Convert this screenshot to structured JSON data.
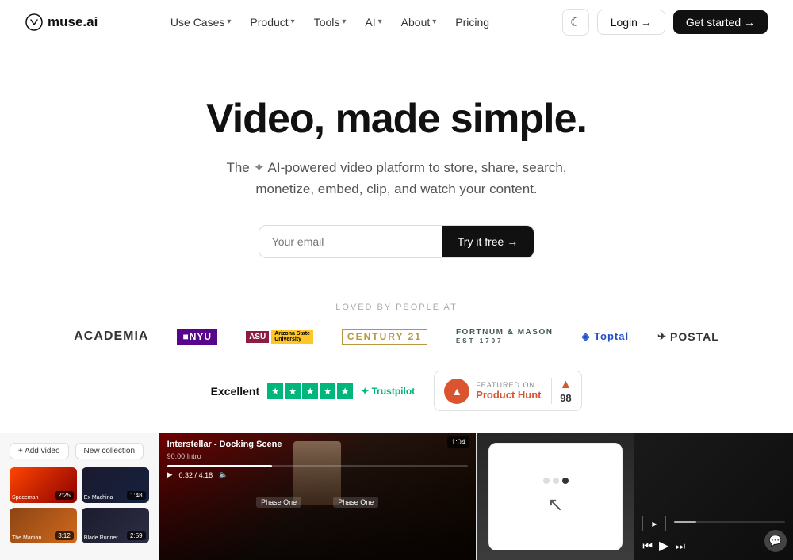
{
  "nav": {
    "logo_text": "muse.ai",
    "links": [
      {
        "label": "Use Cases",
        "has_dropdown": true
      },
      {
        "label": "Product",
        "has_dropdown": true
      },
      {
        "label": "Tools",
        "has_dropdown": true
      },
      {
        "label": "AI",
        "has_dropdown": true
      },
      {
        "label": "About",
        "has_dropdown": true
      },
      {
        "label": "Pricing",
        "has_dropdown": false
      }
    ],
    "login_label": "Login →",
    "get_started_label": "Get started →"
  },
  "hero": {
    "headline": "Video, made simple.",
    "subtext": "The ✦ AI-powered video platform to store, share, search, monetize, embed, clip, and watch your content.",
    "email_placeholder": "Your email",
    "cta_label": "Try it free →"
  },
  "social_proof": {
    "loved_label": "LOVED BY PEOPLE AT",
    "logos": [
      {
        "name": "ACADEMIA",
        "type": "academia"
      },
      {
        "name": "NYU",
        "type": "nyu"
      },
      {
        "name": "ASU",
        "type": "asu"
      },
      {
        "name": "CENTURY 21",
        "type": "century21"
      },
      {
        "name": "FORTNUM & MASON",
        "type": "fortnum"
      },
      {
        "name": "◈ Toptal",
        "type": "toptal"
      },
      {
        "name": "✈ POSTAL",
        "type": "postal"
      }
    ]
  },
  "reviews": {
    "excellent_label": "Excellent",
    "trustpilot_label": "Trustpilot",
    "ph_featured_label": "FEATURED ON",
    "ph_name": "Product Hunt",
    "ph_count": "98"
  },
  "screenshots": [
    {
      "type": "library",
      "add_video_label": "+ Add video",
      "new_collection_label": "New collection",
      "thumbs": [
        {
          "title": "Spaceman",
          "duration": "2:25",
          "color": "spaceman"
        },
        {
          "title": "Ex Machina",
          "duration": "1:48",
          "color": "exmachina"
        },
        {
          "title": "The Martian",
          "duration": "3:12",
          "color": "martian"
        },
        {
          "title": "Blade Runner",
          "duration": "2:59",
          "color": "blade"
        }
      ]
    },
    {
      "type": "player",
      "timestamp": "1:04",
      "chapter1": "Phase One",
      "chapter2": "Phase One",
      "title": "Interstellar - Docking Scene",
      "subtitle": "90:00 Intro",
      "time_current": "0:32",
      "time_total": "4:18"
    },
    {
      "type": "analytics",
      "cursor": "pointer"
    },
    {
      "type": "dark_player"
    }
  ]
}
